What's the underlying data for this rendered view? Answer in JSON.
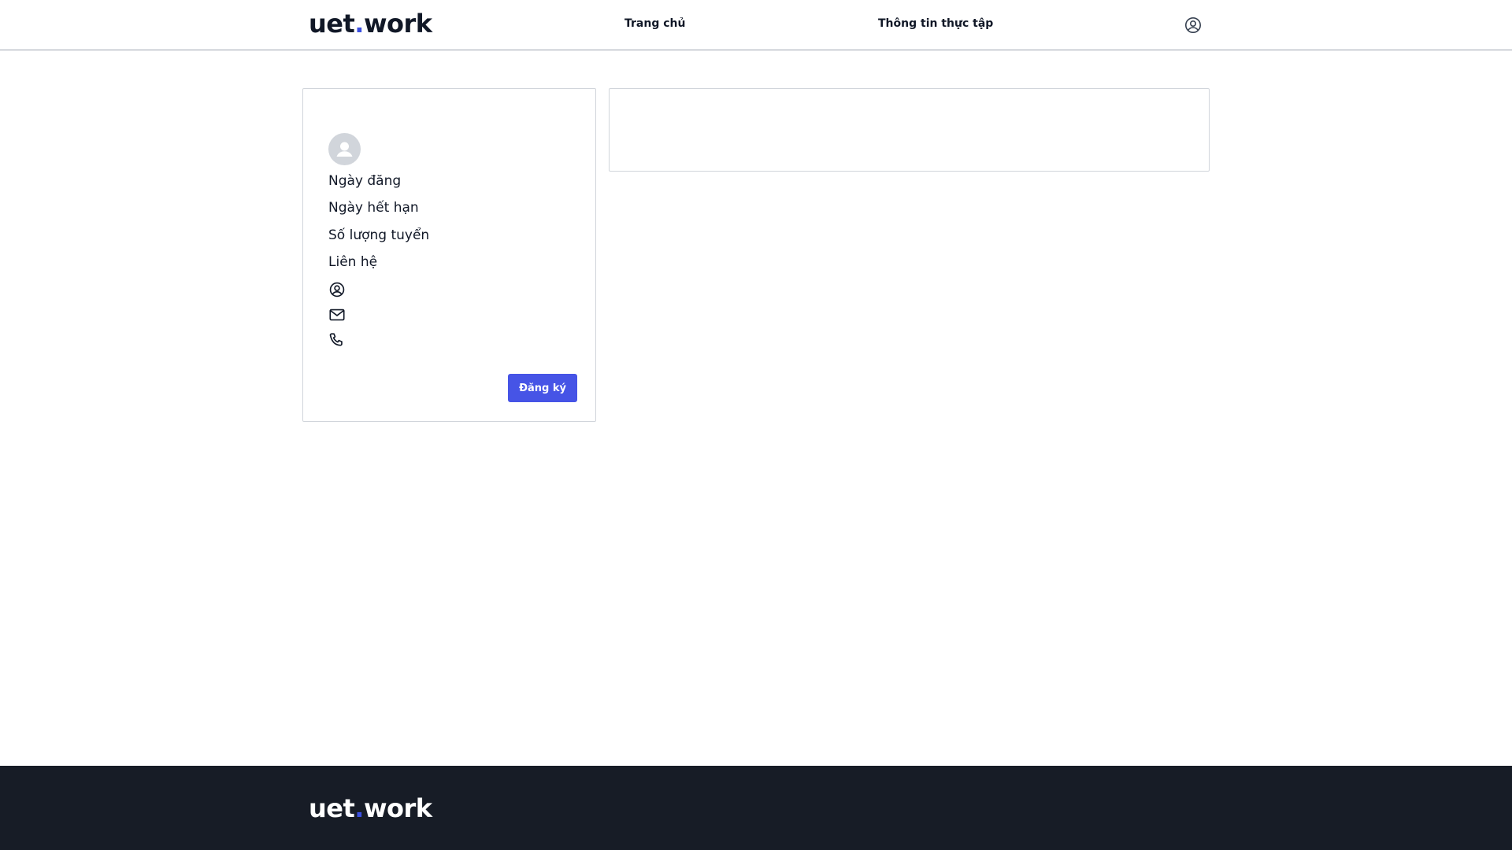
{
  "header": {
    "logo": {
      "part1": "uet",
      "dot": ".",
      "part2": "work"
    },
    "nav": [
      {
        "label": "Trang chủ"
      },
      {
        "label": "Thông tin thực tập"
      }
    ],
    "account_icon": "user-circle-icon"
  },
  "job_card": {
    "avatar_icon": "user-avatar-icon",
    "posted_date_label": "Ngày đăng",
    "expiry_date_label": "Ngày hết hạn",
    "quantity_label": "Số lượng tuyển",
    "contact_label": "Liên hệ",
    "contact_icons": [
      "user-circle-icon",
      "mail-icon",
      "phone-icon"
    ],
    "register_label": "Đăng ký"
  },
  "footer": {
    "logo": {
      "part1": "uet",
      "dot": ".",
      "part2": "work"
    }
  },
  "colors": {
    "accent": "#3b4fe0",
    "button": "#4654e6",
    "footer_bg": "#171c26",
    "border": "#d1d5db"
  }
}
